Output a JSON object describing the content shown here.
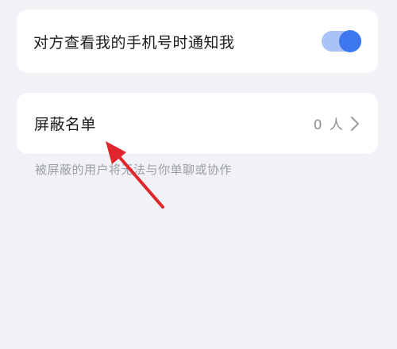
{
  "notify_row": {
    "label": "对方查看我的手机号时通知我",
    "toggle_on": true
  },
  "block_row": {
    "label": "屏蔽名单",
    "count": "0 人"
  },
  "hint": "被屏蔽的用户将无法与你单聊或协作",
  "colors": {
    "background": "#f1f2f5",
    "toggle_track": "#a9c2f8",
    "toggle_knob": "#3d77f0",
    "annotation_arrow": "#e0262c"
  },
  "icons": {
    "chevron": "chevron-right-icon"
  }
}
